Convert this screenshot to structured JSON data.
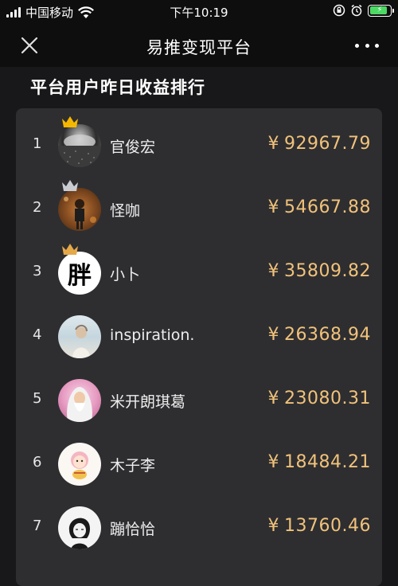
{
  "status_bar": {
    "carrier": "中国移动",
    "time": "下午10:19"
  },
  "nav": {
    "title": "易推变现平台",
    "close_icon": "close-icon",
    "more_icon": "more-icon"
  },
  "section_title": "平台用户昨日收益排行",
  "currency_symbol": "¥",
  "colors": {
    "amount": "#f1c27a",
    "gold_crown": "#f5b800",
    "silver_crown": "#c9ccd1",
    "bronze_crown": "#e6a94a"
  },
  "ranking": [
    {
      "rank": "1",
      "name": "官俊宏",
      "amount": "92967.79",
      "crown": "gold-crown-icon"
    },
    {
      "rank": "2",
      "name": "怪咖",
      "amount": "54667.88",
      "crown": "silver-crown-icon"
    },
    {
      "rank": "3",
      "name": "小卜",
      "amount": "35809.82",
      "crown": "bronze-crown-icon",
      "avatar_text": "胖"
    },
    {
      "rank": "4",
      "name": "inspiration.",
      "amount": "26368.94"
    },
    {
      "rank": "5",
      "name": "米开朗琪葛",
      "amount": "23080.31"
    },
    {
      "rank": "6",
      "name": "木子李",
      "amount": "18484.21"
    },
    {
      "rank": "7",
      "name": "蹦恰恰",
      "amount": "13760.46"
    }
  ]
}
